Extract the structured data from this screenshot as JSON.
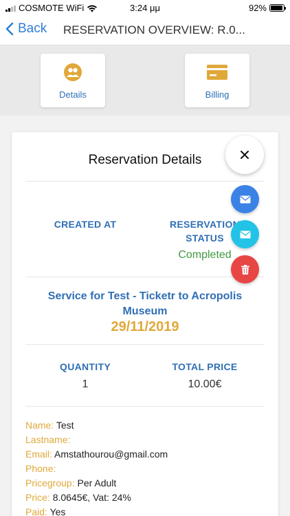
{
  "status_bar": {
    "carrier": "COSMOTE WiFi",
    "time": "3:24 μμ",
    "battery": "92%",
    "battery_level": 0.92
  },
  "nav": {
    "back_label": "Back",
    "title": "RESERVATION OVERVIEW: R.0..."
  },
  "tabs": [
    {
      "label": "Details",
      "icon": "users-icon"
    },
    {
      "label": "Billing",
      "icon": "credit-card-icon"
    }
  ],
  "card": {
    "title": "Reservation Details",
    "created_at_label": "CREATED AT",
    "created_at_value": "",
    "status_label_line1": "RESERVATION",
    "status_label_line2": "STATUS",
    "status_value": "Completed",
    "service_title": "Service for Test - Ticketr to Acropolis Museum",
    "service_date": "29/11/2019",
    "quantity_label": "QUANTITY",
    "quantity_value": "1",
    "total_price_label": "TOTAL PRICE",
    "total_price_value": "10.00€"
  },
  "info": [
    {
      "key": "Name:",
      "value": "Test"
    },
    {
      "key": "Lastname:",
      "value": ""
    },
    {
      "key": "Email:",
      "value": "Amstathourou@gmail.com"
    },
    {
      "key": "Phone:",
      "value": ""
    },
    {
      "key": "Pricegroup:",
      "value": "Per Adult"
    },
    {
      "key": "Price:",
      "value": "8.0645€, Vat: 24%"
    },
    {
      "key": "Paid:",
      "value": "Yes"
    }
  ],
  "fabs": [
    {
      "name": "close",
      "icon": "close-icon"
    },
    {
      "name": "email-blue",
      "icon": "envelope-icon",
      "color": "#3b82e6"
    },
    {
      "name": "email-cyan",
      "icon": "envelope-icon",
      "color": "#22c3e6"
    },
    {
      "name": "delete",
      "icon": "trash-icon",
      "color": "#e84545"
    }
  ],
  "colors": {
    "accent_blue": "#2f6fb5",
    "gold": "#e0a83a",
    "status_green": "#3f9a3f"
  }
}
